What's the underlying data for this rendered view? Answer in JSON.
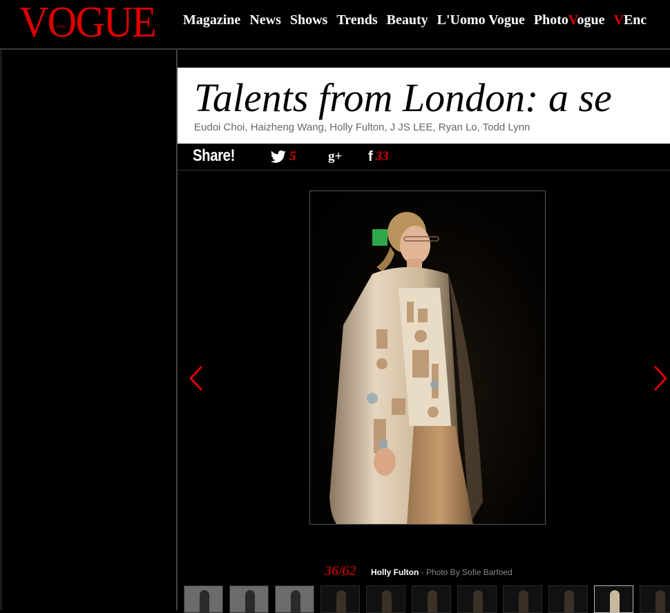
{
  "header": {
    "logo": "VOGUE",
    "logo_sub": "Italia",
    "nav": [
      "Magazine",
      "News",
      "Shows",
      "Trends",
      "Beauty",
      "L'Uomo Vogue"
    ],
    "nav_photo_a": "Photo",
    "nav_photo_v": "V",
    "nav_photo_b": "ogue",
    "nav_enc_v": "V",
    "nav_enc_rest": "Enc"
  },
  "article": {
    "title": "Talents from London: a se",
    "subtitle": "Eudoi Choi, Haizheng Wang, Holly Fulton, J JS LEE, Ryan Lo, Todd Lynn"
  },
  "share": {
    "label": "Share!",
    "twitter_count": "5",
    "gplus_label": "g+",
    "facebook_label": "f",
    "facebook_count": "33"
  },
  "gallery": {
    "counter": "36/62",
    "designer": "Holly Fulton",
    "credit": " - Photo By Sofie Barfoed",
    "thumb_count": 11,
    "active_index": 9
  },
  "colors": {
    "accent": "#e00000",
    "background": "#000000"
  }
}
